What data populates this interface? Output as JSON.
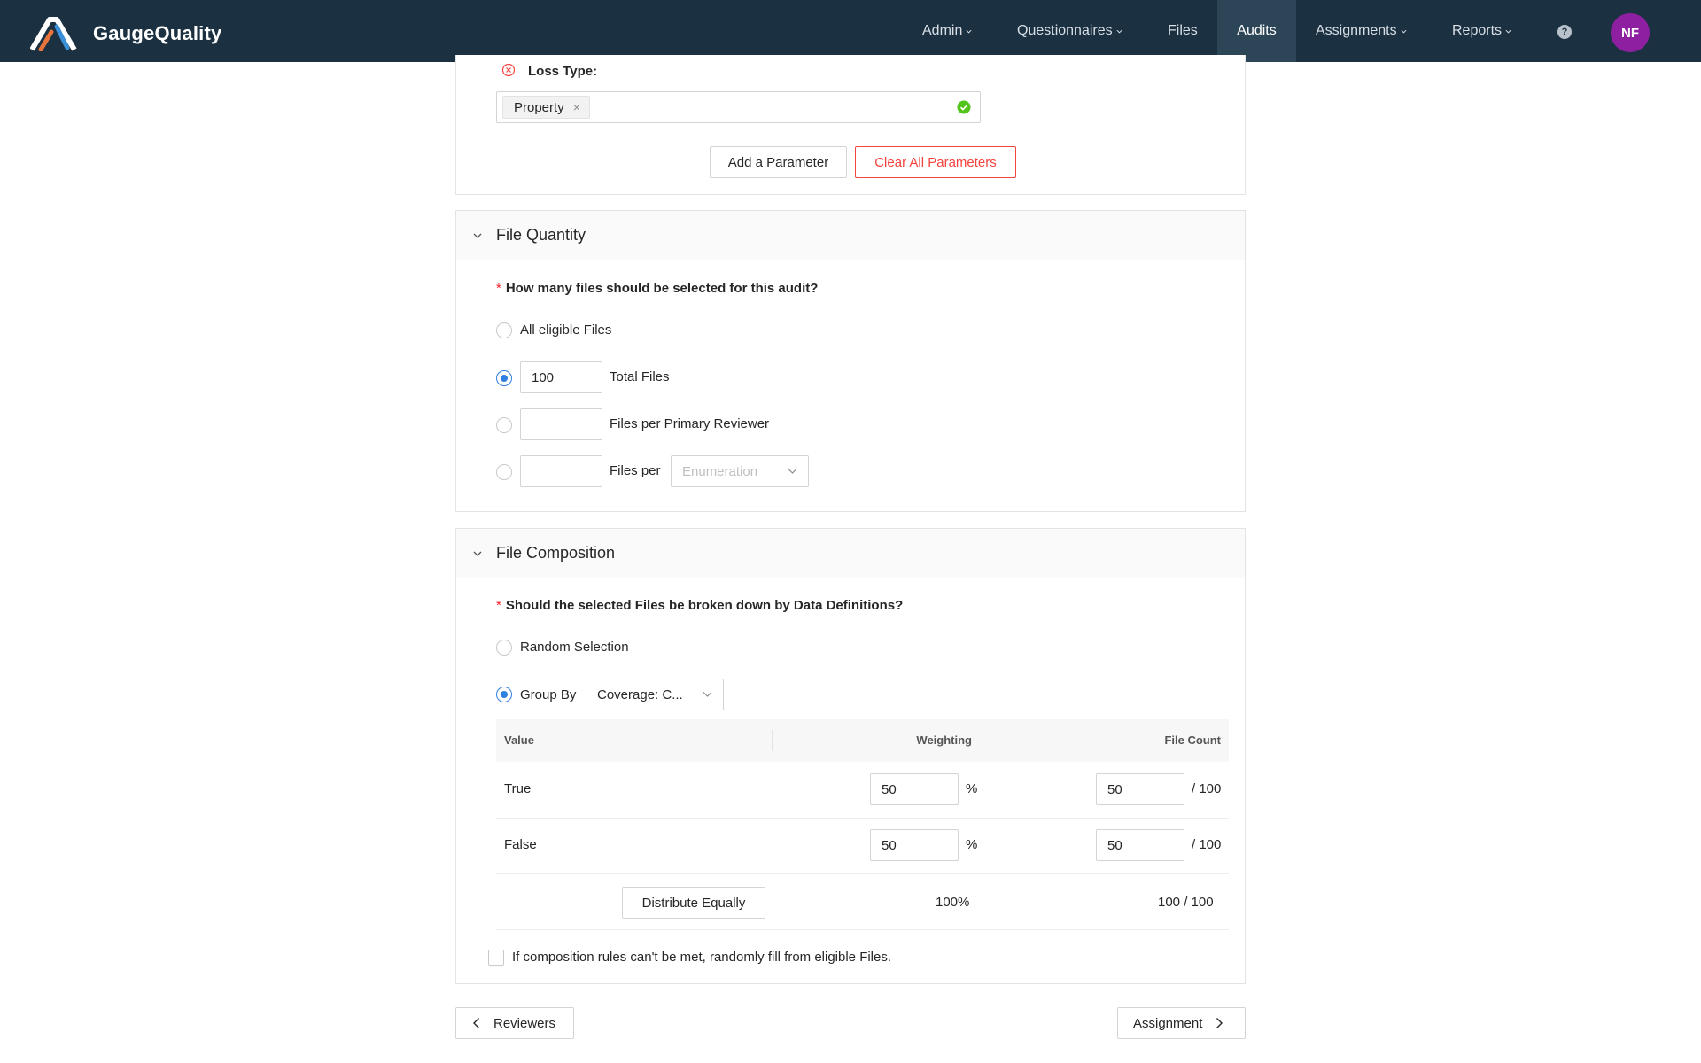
{
  "app": {
    "name": "GaugeQuality",
    "colors": {
      "nav_bg": "#1b3142",
      "accent": "#2f80e0",
      "danger": "#f5443f",
      "avatar": "#8e1fa0",
      "success": "#52c41a"
    }
  },
  "nav": {
    "items": [
      {
        "label": "Admin",
        "dropdown": true
      },
      {
        "label": "Questionnaires",
        "dropdown": true
      },
      {
        "label": "Files",
        "dropdown": false
      },
      {
        "label": "Audits",
        "dropdown": false,
        "active": true
      },
      {
        "label": "Assignments",
        "dropdown": true
      },
      {
        "label": "Reports",
        "dropdown": true
      }
    ],
    "help_icon": "?",
    "avatar_initials": "NF"
  },
  "parameters": {
    "loss_type_label": "Loss Type:",
    "loss_type_tag": "Property",
    "tag_remove": "×",
    "add_button": "Add a Parameter",
    "clear_button": "Clear All Parameters"
  },
  "file_quantity": {
    "title": "File Quantity",
    "question": "How many files should be selected for this audit?",
    "required_mark": "*",
    "options": {
      "all_label": "All eligible Files",
      "total_value": "100",
      "total_label": "Total Files",
      "per_primary_value": "",
      "per_primary_label": "Files per Primary Reviewer",
      "per_value": "",
      "per_label": "Files per",
      "per_select_placeholder": "Enumeration"
    },
    "selected": "total"
  },
  "file_composition": {
    "title": "File Composition",
    "question": "Should the selected Files be broken down by Data Definitions?",
    "required_mark": "*",
    "random_label": "Random Selection",
    "group_by_label": "Group By",
    "group_by_value": "Coverage: C...",
    "selected": "group_by",
    "table": {
      "headers": {
        "value": "Value",
        "weighting": "Weighting",
        "file_count": "File Count"
      },
      "rows": [
        {
          "value": "True",
          "weight": "50",
          "weight_unit": "%",
          "count": "50",
          "count_total": "/ 100"
        },
        {
          "value": "False",
          "weight": "50",
          "weight_unit": "%",
          "count": "50",
          "count_total": "/ 100"
        }
      ],
      "distribute_button": "Distribute Equally",
      "total_weight": "100%",
      "total_count": "100 / 100"
    },
    "fallback_label": "If composition rules can't be met, randomly fill from eligible Files.",
    "fallback_checked": false
  },
  "footer": {
    "back_button": "Reviewers",
    "next_button": "Assignment"
  }
}
